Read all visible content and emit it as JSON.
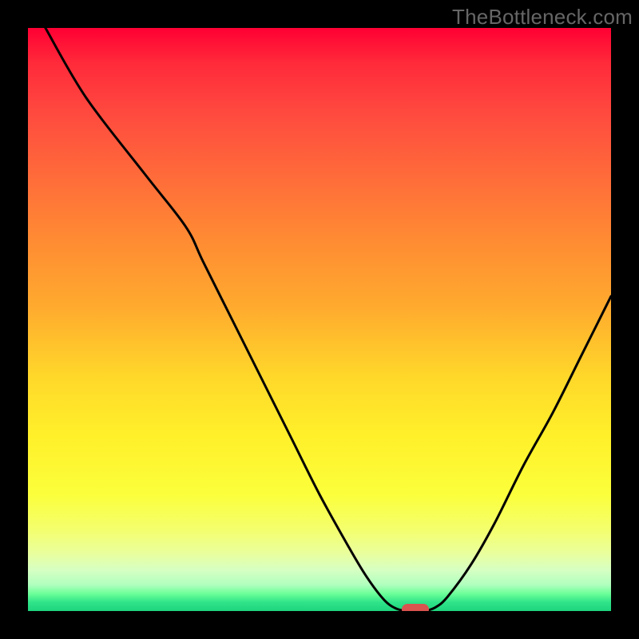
{
  "watermark": "TheBottleneck.com",
  "colors": {
    "frame": "#000000",
    "curve": "#000000",
    "marker": "#d9534f",
    "gradient_top": "#ff0033",
    "gradient_bottom": "#1ed47e"
  },
  "chart_data": {
    "type": "line",
    "title": "",
    "xlabel": "",
    "ylabel": "",
    "xlim": [
      0,
      100
    ],
    "ylim": [
      0,
      100
    ],
    "grid": false,
    "background": "red-yellow-green vertical gradient (bottleneck heat)",
    "x": [
      0,
      5,
      10,
      15,
      20,
      25,
      30,
      35,
      40,
      45,
      50,
      55,
      60,
      62,
      65,
      68,
      70,
      75,
      80,
      85,
      90,
      95,
      100
    ],
    "values": [
      100,
      94,
      88,
      82,
      75,
      68,
      57,
      46,
      36,
      26,
      17,
      9,
      3,
      1,
      0,
      0,
      1,
      6,
      14,
      24,
      34,
      44,
      55
    ],
    "curve": [
      {
        "x": 3.0,
        "y": 100.0
      },
      {
        "x": 10.0,
        "y": 88.0
      },
      {
        "x": 20.0,
        "y": 75.0
      },
      {
        "x": 27.0,
        "y": 66.0
      },
      {
        "x": 30.0,
        "y": 60.0
      },
      {
        "x": 35.0,
        "y": 50.0
      },
      {
        "x": 40.0,
        "y": 40.0
      },
      {
        "x": 45.0,
        "y": 30.0
      },
      {
        "x": 50.0,
        "y": 20.0
      },
      {
        "x": 55.0,
        "y": 11.0
      },
      {
        "x": 58.0,
        "y": 6.0
      },
      {
        "x": 61.0,
        "y": 2.0
      },
      {
        "x": 63.0,
        "y": 0.5
      },
      {
        "x": 65.0,
        "y": 0.0
      },
      {
        "x": 68.0,
        "y": 0.0
      },
      {
        "x": 70.0,
        "y": 0.7
      },
      {
        "x": 72.0,
        "y": 2.5
      },
      {
        "x": 76.0,
        "y": 8.0
      },
      {
        "x": 80.0,
        "y": 15.0
      },
      {
        "x": 85.0,
        "y": 25.0
      },
      {
        "x": 90.0,
        "y": 34.0
      },
      {
        "x": 95.0,
        "y": 44.0
      },
      {
        "x": 100.0,
        "y": 54.0
      }
    ],
    "marker": {
      "x": 66.5,
      "y": 0.3
    },
    "annotations": []
  }
}
